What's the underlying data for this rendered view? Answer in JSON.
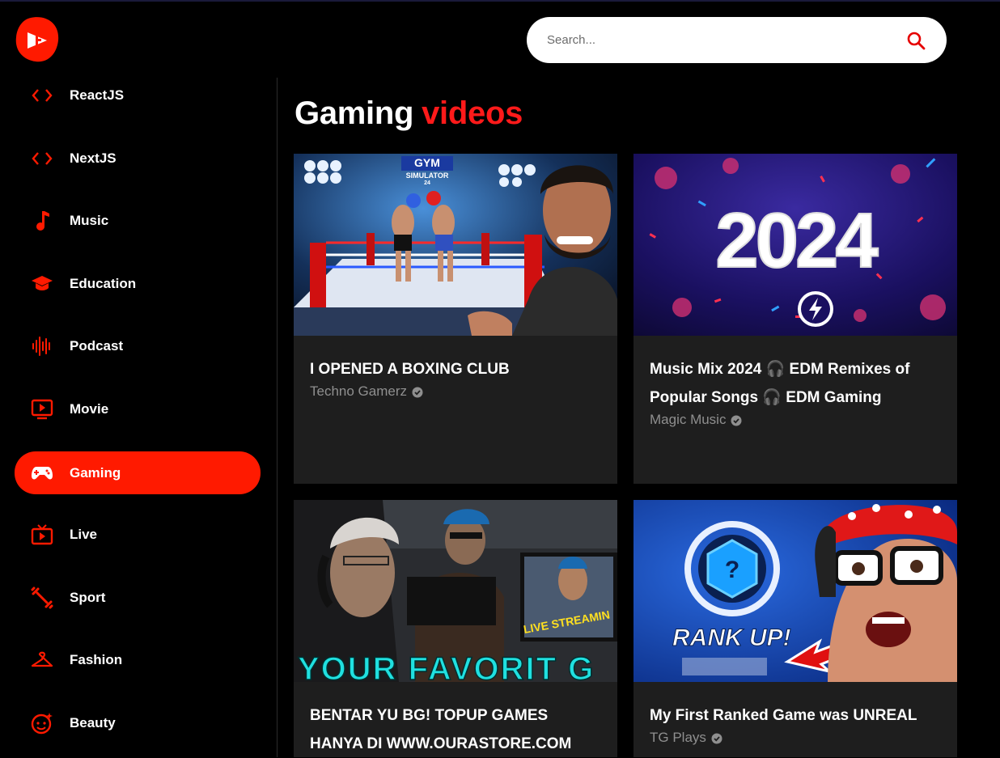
{
  "search": {
    "placeholder": "Search..."
  },
  "sidebar": {
    "items": [
      {
        "label": "ReactJS",
        "icon": "code-icon"
      },
      {
        "label": "NextJS",
        "icon": "code-icon"
      },
      {
        "label": "Music",
        "icon": "music-note-icon"
      },
      {
        "label": "Education",
        "icon": "graduation-cap-icon"
      },
      {
        "label": "Podcast",
        "icon": "soundwave-icon"
      },
      {
        "label": "Movie",
        "icon": "play-screen-icon"
      },
      {
        "label": "Gaming",
        "icon": "gamepad-icon",
        "active": true
      },
      {
        "label": "Live",
        "icon": "tv-icon"
      },
      {
        "label": "Sport",
        "icon": "dumbbell-icon"
      },
      {
        "label": "Fashion",
        "icon": "hanger-icon"
      },
      {
        "label": "Beauty",
        "icon": "face-sparkle-icon"
      }
    ]
  },
  "main": {
    "heading": "Gaming",
    "heading_accent": "videos",
    "videos": [
      {
        "title": "I OPENED A BOXING CLUB",
        "channel": "Techno Gamerz",
        "verified": true,
        "thumb_text": "GYM SIMULATOR 24"
      },
      {
        "title": "Music Mix 2024 🎧 EDM Remixes of Popular Songs 🎧 EDM Gaming",
        "channel": "Magic Music",
        "verified": true,
        "thumb_text": "2024"
      },
      {
        "title": "BENTAR YU BG! TOPUP GAMES HANYA DI WWW.OURASTORE.COM",
        "channel": "",
        "verified": false,
        "thumb_text": "YOUR FAVORIT G",
        "thumb_text2": "LIVE STREAMIN"
      },
      {
        "title": "My First Ranked Game was UNREAL",
        "channel": "TG Plays",
        "verified": true,
        "thumb_text": "RANK UP!"
      }
    ]
  },
  "colors": {
    "accent": "#ff1a00",
    "card_bg": "#1e1e1e",
    "page_bg": "#000000"
  }
}
